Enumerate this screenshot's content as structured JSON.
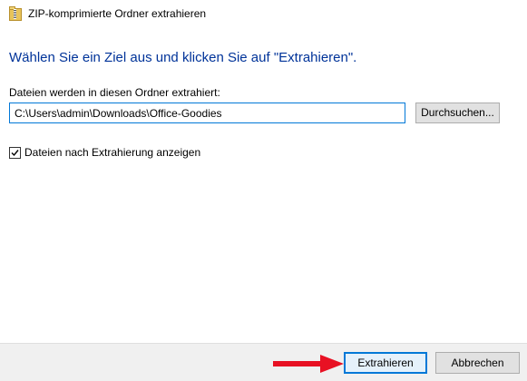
{
  "window": {
    "title": "ZIP-komprimierte Ordner extrahieren",
    "title_icon": "zip-folder-icon"
  },
  "main": {
    "heading": "Wählen Sie ein Ziel aus und klicken Sie auf \"Extrahieren\".",
    "destination_label": "Dateien werden in diesen Ordner extrahiert:",
    "destination_path": "C:\\Users\\admin\\Downloads\\Office-Goodies",
    "browse_label": "Durchsuchen...",
    "show_files_label": "Dateien nach Extrahierung anzeigen",
    "show_files_checked": true
  },
  "footer": {
    "extract_label": "Extrahieren",
    "cancel_label": "Abbrechen"
  },
  "annotation": {
    "arrow_color": "#e81123",
    "arrow_icon": "right-arrow-icon"
  },
  "colors": {
    "heading": "#003399",
    "accent": "#0078d7"
  }
}
